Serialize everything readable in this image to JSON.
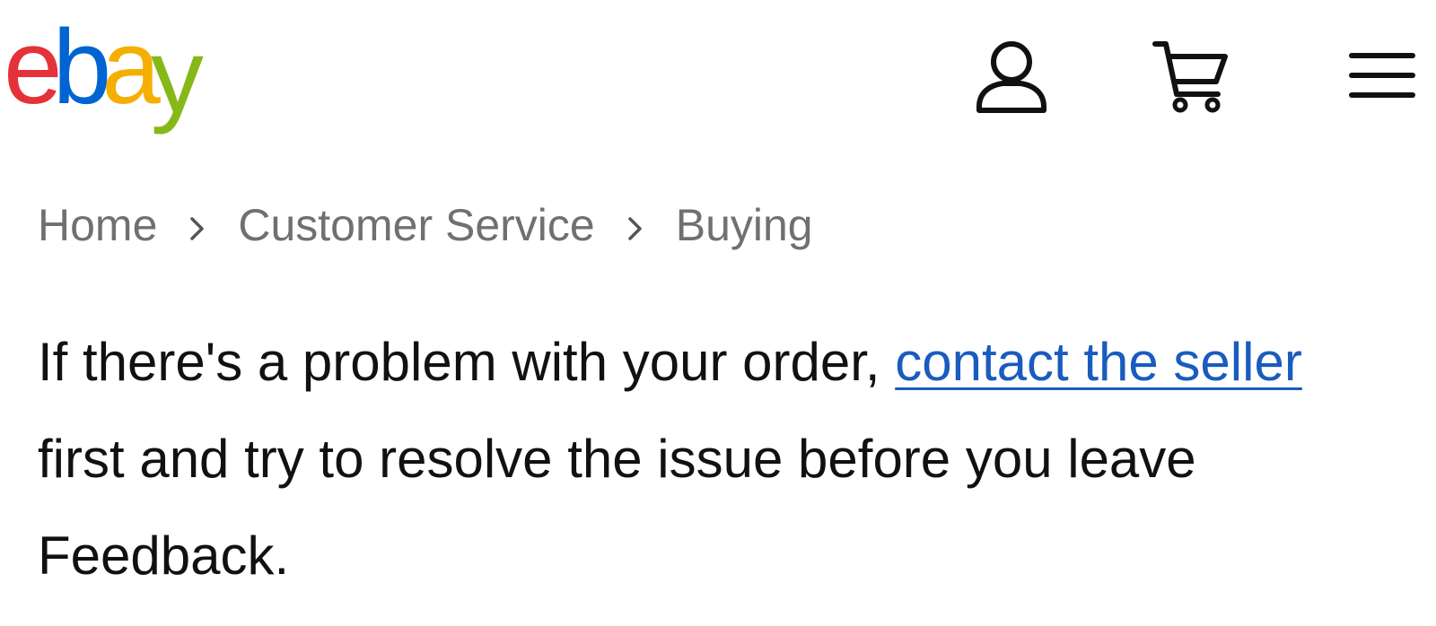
{
  "header": {
    "logo": {
      "text": "ebay",
      "letters": [
        {
          "char": "e",
          "color": "#e53238"
        },
        {
          "char": "b",
          "color": "#0064d2"
        },
        {
          "char": "a",
          "color": "#f5af02"
        },
        {
          "char": "y",
          "color": "#86b817"
        }
      ]
    },
    "icons": {
      "account": "user-icon",
      "cart": "cart-icon",
      "menu": "hamburger-menu-icon"
    }
  },
  "breadcrumb": {
    "items": [
      {
        "label": "Home"
      },
      {
        "label": "Customer Service"
      },
      {
        "label": "Buying"
      }
    ],
    "separator_icon": "chevron-right-icon"
  },
  "message": {
    "text_before": "If there's a problem with your order, ",
    "link_label": "contact the seller",
    "text_after": " first and try to resolve the issue before you leave Feedback."
  },
  "colors": {
    "link": "#1a5bbf",
    "breadcrumb": "#707070",
    "body_text": "#111111"
  }
}
